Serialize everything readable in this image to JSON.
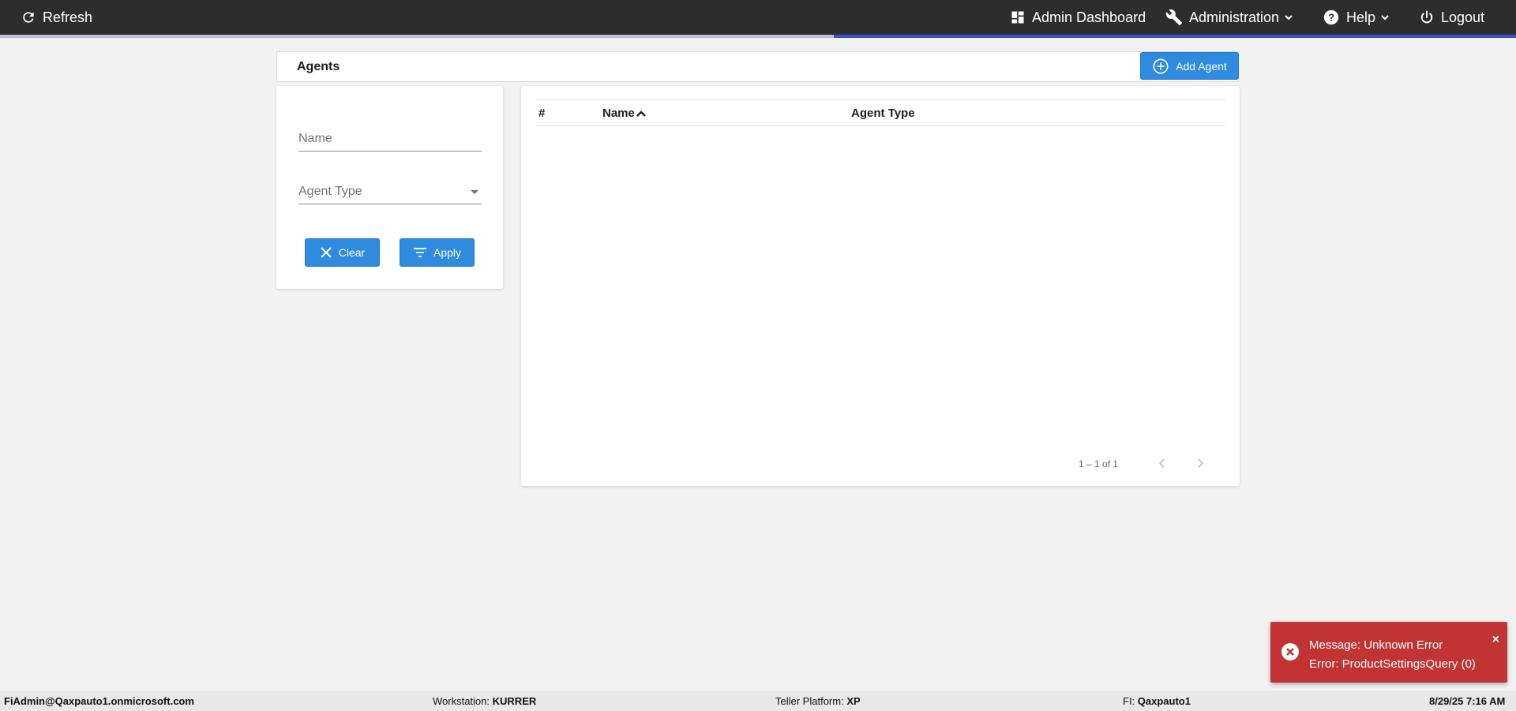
{
  "topbar": {
    "refresh_label": "Refresh",
    "admin_dashboard_label": "Admin Dashboard",
    "administration_label": "Administration",
    "help_label": "Help",
    "logout_label": "Logout",
    "icons": {
      "refresh": "refresh-icon",
      "dashboard": "dashboard-icon",
      "administration": "wrench-icon",
      "help": "help-icon",
      "logout": "power-icon"
    },
    "progress": 0.45
  },
  "page": {
    "title": "Agents",
    "add_button_label": "Add Agent"
  },
  "filters": {
    "name_placeholder": "Name",
    "agent_type_placeholder": "Agent Type",
    "clear_label": "Clear",
    "apply_label": "Apply"
  },
  "table": {
    "columns": [
      "#",
      "Name",
      "Agent Type"
    ],
    "sorted_column": "Name",
    "sort_direction": "ascending",
    "rows": [],
    "paginator_label": "1 – 1 of 1"
  },
  "toast": {
    "line1": "Message: Unknown Error",
    "line2": "Error: ProductSettingsQuery (0)",
    "close_symbol": "×"
  },
  "statusbar": {
    "user": "FiAdmin@Qaxpauto1.onmicrosoft.com",
    "workstation_label": "Workstation:",
    "workstation_value": "KURRER",
    "platform_label": "Teller Platform:",
    "platform_value": "XP",
    "fi_label": "FI:",
    "fi_value": "Qaxpauto1",
    "datetime": "8/29/25 7:16 AM"
  },
  "colors": {
    "topbar": "#2d2d2d",
    "accent": "#2f8be0",
    "progress": "#3c4fd1",
    "error": "#c23334",
    "background": "#f2f2f3"
  }
}
